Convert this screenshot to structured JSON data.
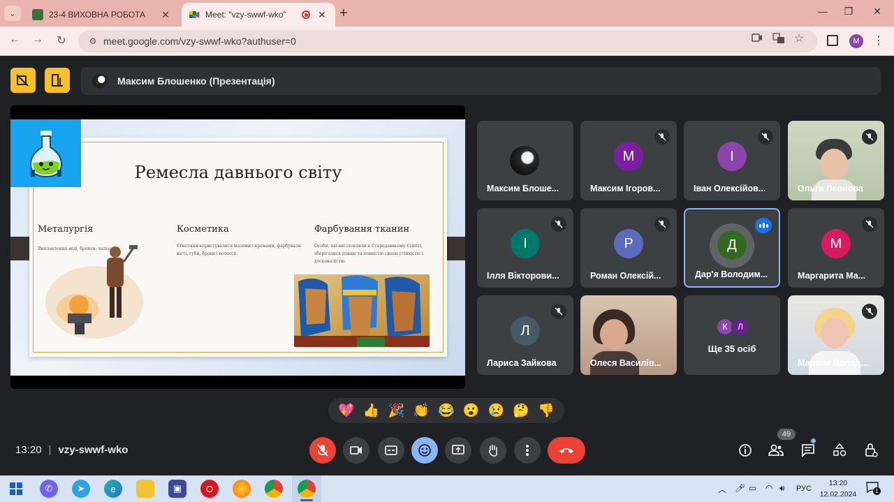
{
  "browser": {
    "tabs": [
      {
        "title": "23-4 ВИХОВНА РОБОТА",
        "active": false
      },
      {
        "title": "Meet: \"vzy-swwf-wko\"",
        "active": true
      }
    ],
    "url": "meet.google.com/vzy-swwf-wko?authuser=0",
    "profile_initial": "M"
  },
  "meet": {
    "presenter": "Максим Блошенко (Презентація)",
    "time": "13:20",
    "separator": "|",
    "meeting_code": "vzy-swwf-wko",
    "participant_count": "49",
    "slide": {
      "title": "Ремесла давнього світу",
      "columns": [
        {
          "heading": "Металургія",
          "text": "Виплавлення міді, бронзи, заліза."
        },
        {
          "heading": "Косметика",
          "text": "Єгиптяни користувалися мазями і кремами, фарбували нігті, губи, брови і волосся."
        },
        {
          "heading": "Фарбування тканин",
          "text": "Особи, які виготовляли в Стародавньому Єгипті, зберігалися довше та повністю своєю стійкістю і досконалістю."
        }
      ]
    },
    "participants": [
      {
        "name": "Максим Блоше...",
        "initial": "",
        "color": "",
        "muted": false,
        "photo": true
      },
      {
        "name": "Максим Ігоров...",
        "initial": "М",
        "color": "#7b1fa2",
        "muted": true
      },
      {
        "name": "Іван Олексійов...",
        "initial": "І",
        "color": "#8e44ad",
        "muted": true
      },
      {
        "name": "Ольга Леонова",
        "initial": "",
        "color": "",
        "muted": true,
        "photo": true
      },
      {
        "name": "Ілля Вікторови...",
        "initial": "І",
        "color": "#00796b",
        "muted": true
      },
      {
        "name": "Роман Олексій...",
        "initial": "Р",
        "color": "#5c6bc0",
        "muted": true
      },
      {
        "name": "Дар'я Володим...",
        "initial": "Д",
        "color": "#33691e",
        "muted": false,
        "speaking": true
      },
      {
        "name": "Маргарита Ма...",
        "initial": "М",
        "color": "#d81b60",
        "muted": true
      },
      {
        "name": "Лариса Зайкова",
        "initial": "Л",
        "color": "#455a64",
        "muted": true
      },
      {
        "name": "Олеся Василів...",
        "initial": "",
        "color": "",
        "muted": false,
        "photo": true
      },
      {
        "name": "Марина Волод...",
        "initial": "",
        "color": "",
        "muted": true,
        "photo": true
      }
    ],
    "more": {
      "label": "Ще 35 осіб",
      "initials": [
        "К",
        "Л"
      ],
      "colors": [
        "#8e44ad",
        "#6a1b9a"
      ]
    },
    "reactions": [
      "💖",
      "👍",
      "🎉",
      "👏",
      "😂",
      "😮",
      "😢",
      "🤔",
      "👎"
    ]
  },
  "taskbar": {
    "language": "РУС",
    "time": "13:20",
    "date": "12.02.2024",
    "notification_count": "1"
  }
}
